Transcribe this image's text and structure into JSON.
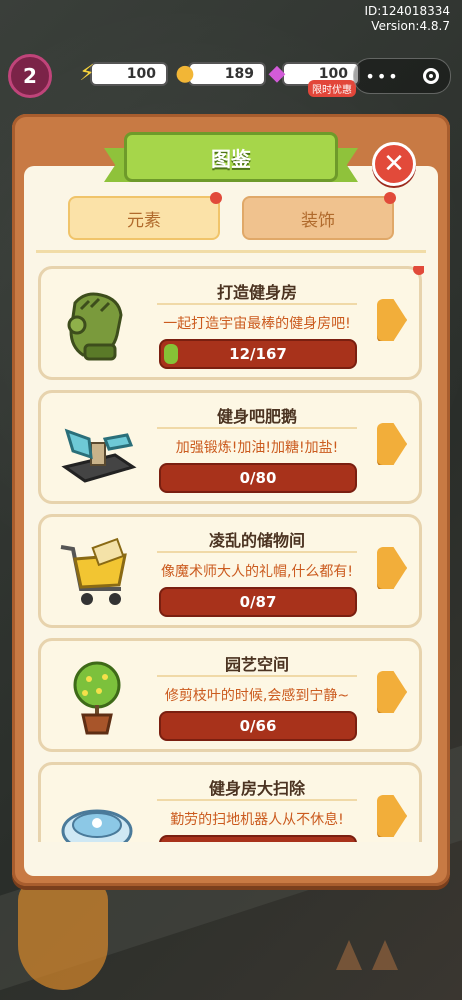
{
  "version": {
    "id": "ID:124018334",
    "ver": "Version:4.8.7"
  },
  "topbar": {
    "level": "2",
    "resources": [
      {
        "icon": "energy-icon",
        "value": "100"
      },
      {
        "icon": "coin-icon",
        "value": "189"
      },
      {
        "icon": "gem-icon",
        "value": "100"
      }
    ],
    "limited": "限时优惠"
  },
  "panel": {
    "title": "图鉴",
    "tabs": [
      {
        "label": "元素",
        "badge": true
      },
      {
        "label": "装饰",
        "badge": true
      }
    ],
    "cards": [
      {
        "title": "打造健身房",
        "desc": "一起打造宇宙最棒的健身房吧!",
        "progress": "12/167",
        "fraction": 0.072,
        "icon": "glove-icon",
        "badge": true
      },
      {
        "title": "健身吧肥鹅",
        "desc": "加强锻炼!加油!加糖!加盐!",
        "progress": "0/80",
        "fraction": 0,
        "icon": "bench-icon",
        "badge": false
      },
      {
        "title": "凌乱的储物间",
        "desc": "像魔术师大人的礼帽,什么都有!",
        "progress": "0/87",
        "fraction": 0,
        "icon": "cart-icon",
        "badge": false
      },
      {
        "title": "园艺空间",
        "desc": "修剪枝叶的时候,会感到宁静~",
        "progress": "0/66",
        "fraction": 0,
        "icon": "plant-icon",
        "badge": false
      },
      {
        "title": "健身房大扫除",
        "desc": "勤劳的扫地机器人从不休息!",
        "progress": "",
        "fraction": 0,
        "icon": "robot-vacuum-icon",
        "badge": false
      }
    ]
  }
}
